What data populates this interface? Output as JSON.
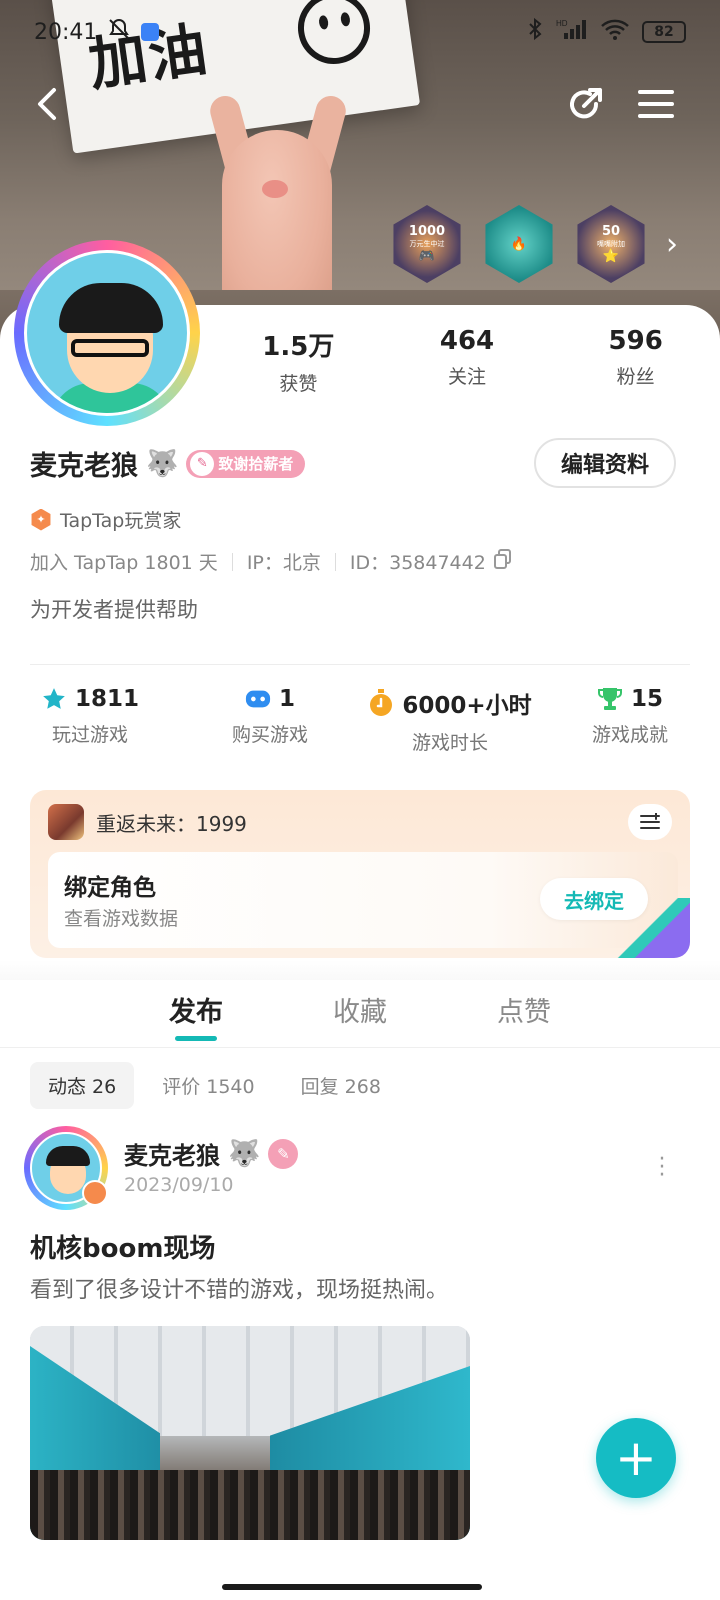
{
  "status_bar": {
    "time": "20:41",
    "network": "HD",
    "battery": "82"
  },
  "banner": {
    "card_text": "加油"
  },
  "badges": [
    {
      "value": "1000",
      "sub": "万元生中过"
    },
    {
      "value": "",
      "sub": ""
    },
    {
      "value": "50",
      "sub": "嘴嘴附加"
    }
  ],
  "profile": {
    "stats": [
      {
        "value": "1.5万",
        "label": "获赞"
      },
      {
        "value": "464",
        "label": "关注"
      },
      {
        "value": "596",
        "label": "粉丝"
      }
    ],
    "name": "麦克老狼",
    "name_emoji": "🐺",
    "tag": "致谢拾薪者",
    "edit_button": "编辑资料",
    "title": "TapTap玩赏家",
    "info": {
      "joined": "加入 TapTap 1801 天",
      "ip": "IP：北京",
      "id": "ID：35847442"
    },
    "bio": "为开发者提供帮助"
  },
  "game_stats": [
    {
      "value": "1811",
      "label": "玩过游戏",
      "icon": "star-icon",
      "color": "#22b5c8"
    },
    {
      "value": "1",
      "label": "购买游戏",
      "icon": "gamepad-icon",
      "color": "#2f8df0"
    },
    {
      "value": "6000+小时",
      "label": "游戏时长",
      "icon": "stopwatch-icon",
      "color": "#f5a623"
    },
    {
      "value": "15",
      "label": "游戏成就",
      "icon": "trophy-icon",
      "color": "#36c46a"
    }
  ],
  "bind_card": {
    "game_name": "重返未来：1999",
    "title": "绑定角色",
    "subtitle": "查看游戏数据",
    "button": "去绑定"
  },
  "tabs": [
    {
      "label": "发布",
      "active": true
    },
    {
      "label": "收藏",
      "active": false
    },
    {
      "label": "点赞",
      "active": false
    }
  ],
  "subtabs": [
    {
      "label": "动态 26",
      "active": true
    },
    {
      "label": "评价 1540",
      "active": false
    },
    {
      "label": "回复 268",
      "active": false
    }
  ],
  "post": {
    "author": "麦克老狼",
    "author_emoji": "🐺",
    "date": "2023/09/10",
    "title": "机核boom现场",
    "body": "看到了很多设计不错的游戏，现场挺热闹。"
  },
  "fab_label": "+",
  "colors": {
    "accent": "#15bcc4",
    "tag_pink": "#f4a0b6",
    "title_orange": "#f58a4c"
  }
}
